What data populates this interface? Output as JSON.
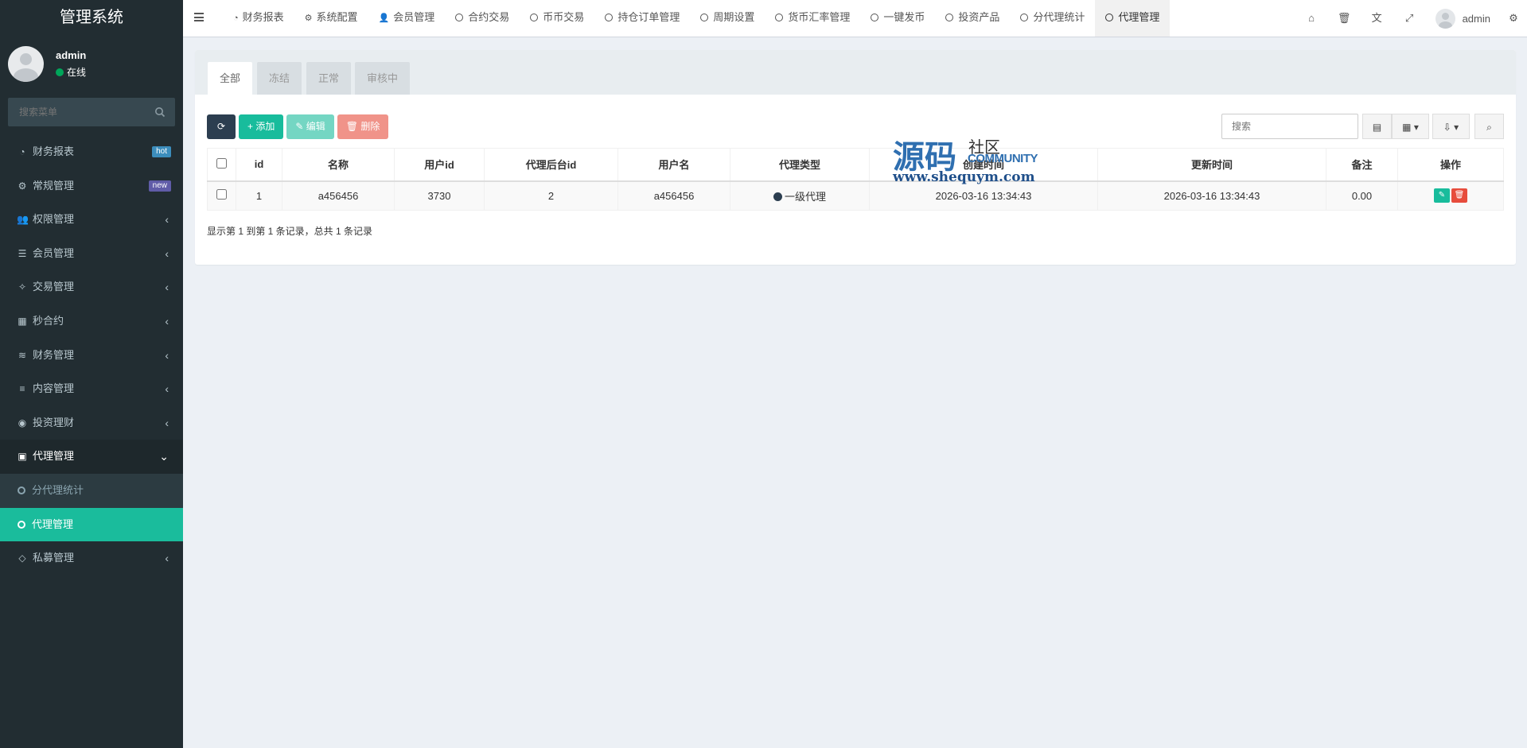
{
  "brand": "管理系统",
  "user": {
    "name": "admin",
    "status": "在线"
  },
  "sidebar_search": {
    "placeholder": "搜索菜单"
  },
  "menu": [
    {
      "label": "财务报表",
      "icon": "dashboard-icon",
      "glyph": "◔",
      "badge": "hot"
    },
    {
      "label": "常规管理",
      "icon": "cogs-icon",
      "glyph": "⚙",
      "badge": "new"
    },
    {
      "label": "权限管理",
      "icon": "group-icon",
      "glyph": "👥",
      "chevron": "‹"
    },
    {
      "label": "会员管理",
      "icon": "list-icon",
      "glyph": "☰",
      "chevron": "‹"
    },
    {
      "label": "交易管理",
      "icon": "handshake-icon",
      "glyph": "✧",
      "chevron": "‹"
    },
    {
      "label": "秒合约",
      "icon": "calendar-icon",
      "glyph": "▦",
      "chevron": "‹"
    },
    {
      "label": "财务管理",
      "icon": "database-icon",
      "glyph": "≋",
      "chevron": "‹"
    },
    {
      "label": "内容管理",
      "icon": "align-left-icon",
      "glyph": "≡",
      "chevron": "‹"
    },
    {
      "label": "投资理财",
      "icon": "compass-icon",
      "glyph": "◉",
      "chevron": "‹"
    },
    {
      "label": "代理管理",
      "icon": "briefcase-icon",
      "glyph": "▣",
      "chevron": "⌄"
    },
    {
      "label": "分代理统计",
      "sub": true
    },
    {
      "label": "代理管理",
      "sub": true,
      "active": true
    },
    {
      "label": "私募管理",
      "icon": "diamond-icon",
      "glyph": "◇",
      "chevron": "‹"
    }
  ],
  "nav_tabs": [
    {
      "label": "财务报表",
      "glyph": "◔"
    },
    {
      "label": "系统配置",
      "glyph": "⚙"
    },
    {
      "label": "会员管理",
      "glyph": "👤"
    },
    {
      "label": "合约交易"
    },
    {
      "label": "币币交易"
    },
    {
      "label": "持仓订单管理"
    },
    {
      "label": "周期设置"
    },
    {
      "label": "货币汇率管理"
    },
    {
      "label": "一键发币"
    },
    {
      "label": "投资产品"
    },
    {
      "label": "分代理统计"
    },
    {
      "label": "代理管理",
      "active": true
    }
  ],
  "topbar_user": "admin",
  "filter_tabs": [
    "全部",
    "冻结",
    "正常",
    "审核中"
  ],
  "toolbar": {
    "add": "添加",
    "edit": "编辑",
    "delete": "删除"
  },
  "table_search": {
    "placeholder": "搜索"
  },
  "table": {
    "columns": [
      "id",
      "名称",
      "用户id",
      "代理后台id",
      "用户名",
      "代理类型",
      "创建时间",
      "更新时间",
      "备注",
      "操作"
    ],
    "rows": [
      {
        "id": "1",
        "name": "a456456",
        "user_id": "3730",
        "agent_admin_id": "2",
        "username": "a456456",
        "agent_type": "一级代理",
        "created": "2026-03-16 13:34:43",
        "updated": "2026-03-16 13:34:43",
        "remark": "0.00"
      }
    ]
  },
  "summary": "显示第 1 到第 1 条记录，总共 1 条记录",
  "watermark": {
    "big": "源码",
    "small": "社区",
    "community": "COMMUNITY",
    "url": "www.shequym.com"
  },
  "colors": {
    "sidebar": "#222d32",
    "accent": "#1abc9c",
    "danger": "#e74c3c",
    "dark": "#2c3e50"
  }
}
